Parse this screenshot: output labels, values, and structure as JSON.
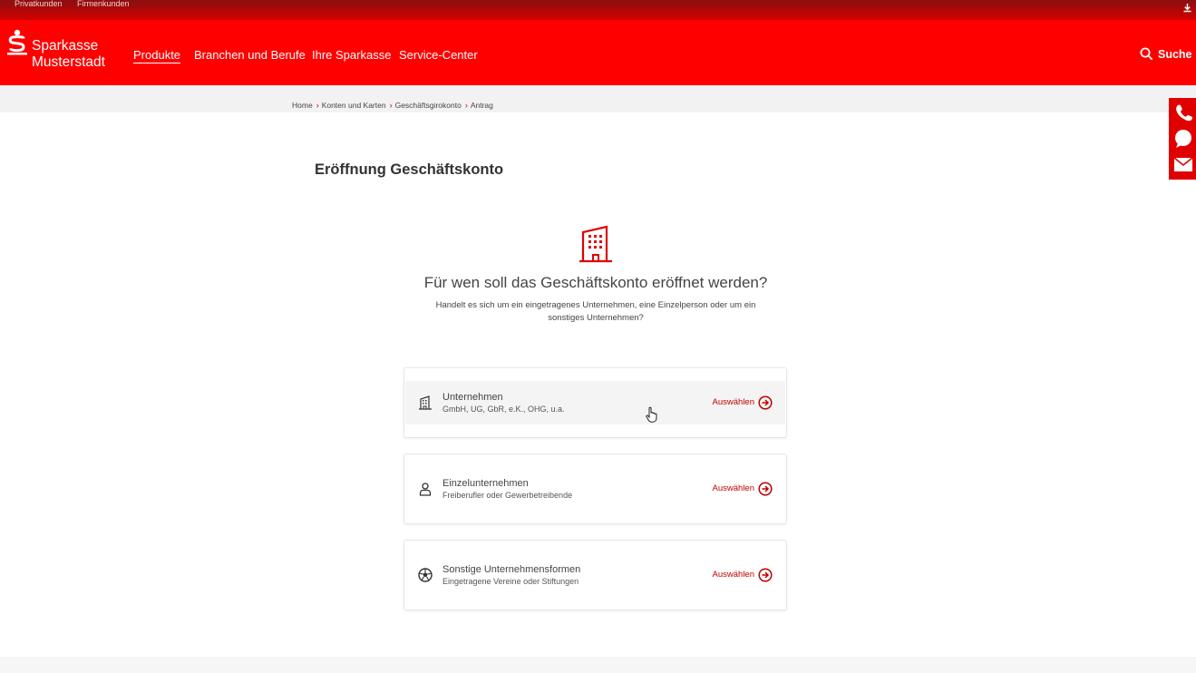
{
  "topbar": {
    "segments": [
      "Privatkunden",
      "Firmenkunden"
    ]
  },
  "header": {
    "brand_line1": "Sparkasse",
    "brand_line2": "Musterstadt",
    "nav": [
      "Produkte",
      "Branchen und Berufe",
      "Ihre Sparkasse",
      "Service-Center"
    ],
    "active_nav": "Produkte",
    "search_label": "Suche"
  },
  "breadcrumb": [
    "Home",
    "Konten und Karten",
    "Geschäftsgirokonto",
    "Antrag"
  ],
  "page_title": "Eröffnung Geschäftskonto",
  "question": {
    "title": "Für wen soll das Geschäftskonto eröffnet werden?",
    "subtitle": "Handelt es sich um ein eingetragenes Unternehmen, eine Einzelperson oder um ein sonstiges Unternehmen?"
  },
  "options": [
    {
      "title": "Unternehmen",
      "subtitle": "GmbH, UG, GbR, e.K., OHG, u.a.",
      "action": "Auswählen",
      "icon": "building-icon"
    },
    {
      "title": "Einzelunternehmen",
      "subtitle": "Freiberufler oder Gewerbetreibende",
      "action": "Auswählen",
      "icon": "person-icon"
    },
    {
      "title": "Sonstige Unternehmensformen",
      "subtitle": "Eingetragene Vereine oder Stiftungen",
      "action": "Auswählen",
      "icon": "ball-icon"
    }
  ],
  "colors": {
    "brand": "#ff0000",
    "accent": "#c00000"
  }
}
